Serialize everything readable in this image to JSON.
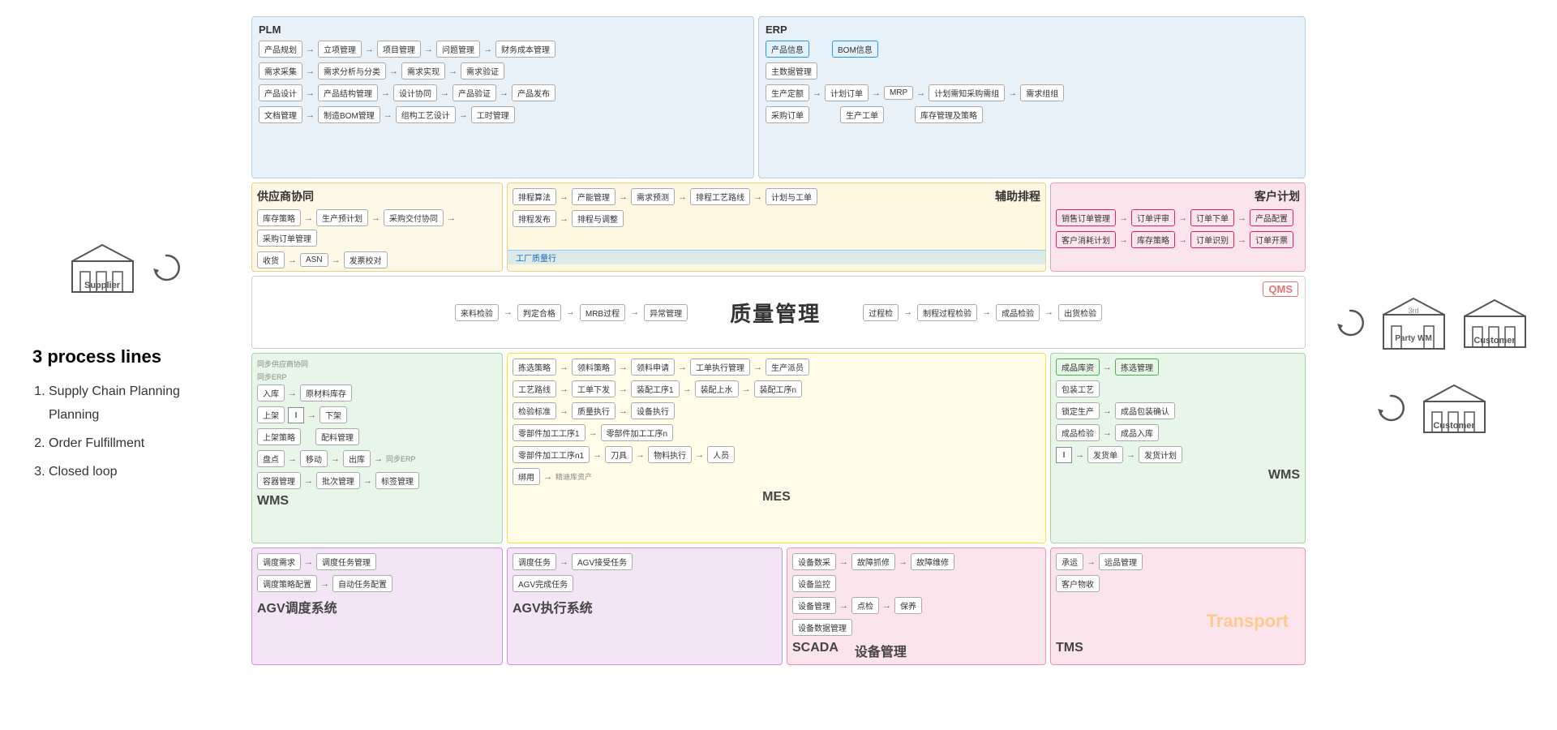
{
  "left": {
    "supplier_label": "Supplier",
    "process_title": "3 process lines",
    "process_items": [
      "Supply Chain Planning",
      "Order Fulfillment",
      "Closed loop"
    ]
  },
  "right": {
    "third_party_label": "3rd\nParty WM",
    "customer1_label": "Customer",
    "customer2_label": "Customer"
  },
  "diagram": {
    "plm_title": "PLM",
    "erp_title": "ERP",
    "supplier_coop_title": "供应商协同",
    "scheduling_title": "辅助排程",
    "customer_plan_title": "客户计划",
    "quality_title": "质量管理",
    "wms_left_title": "WMS",
    "mes_title": "MES",
    "wms_right_title": "WMS",
    "agv_left_title": "AGV调度系统",
    "agv_mid_title": "AGV执行系统",
    "scada_title": "SCADA",
    "equipment_title": "设备管理",
    "tms_title": "TMS",
    "qms_label": "QMS",
    "transport_label": "Transport"
  },
  "plm_nodes": [
    "产品规划",
    "立项管理",
    "项目管理",
    "问题管理",
    "财务成本管理",
    "需求采集",
    "需求分析与分类",
    "需求实现",
    "需求验证",
    "产品设计",
    "产品结构管理",
    "设计协同",
    "产品验证",
    "产品发布",
    "文档管理",
    "制造BOM管理",
    "组构工艺设计",
    "工时管理"
  ],
  "erp_nodes": [
    "产品信息",
    "BOM信息",
    "主数据管理",
    "生产定额",
    "计划订单",
    "MRP",
    "计划需知采购需组",
    "需求组组",
    "库存管理及策略",
    "采购订单",
    "生产工单"
  ],
  "supplier_nodes": [
    "库存策略",
    "生产预计划",
    "采购交付协同",
    "采购订单管理",
    "收货",
    "ASN",
    "发票校对"
  ],
  "scheduling_nodes": [
    "排程算法",
    "产能管理",
    "需求预测",
    "排程工艺路线",
    "计划与工单",
    "排程发布",
    "排程与调整"
  ],
  "customer_plan_nodes": [
    "销售订单管理",
    "订单评审",
    "订单下单",
    "产品配置",
    "客户消耗计划",
    "库存策略",
    "订单识别",
    "订单开票"
  ],
  "quality_nodes": [
    "来料检验",
    "判定合格",
    "MRB过程",
    "异常管理",
    "过程检",
    "制程过程检验",
    "成品检验",
    "出货检验"
  ],
  "wms_nodes": [
    "同步供应商协同",
    "同步ERP",
    "入库",
    "原材料库存",
    "上架",
    "下架",
    "上架策略",
    "盘点",
    "移动",
    "出库",
    "配料管理",
    "容器管理",
    "批次管理",
    "标签管理"
  ],
  "mes_nodes": [
    "拣选策略",
    "领料策略",
    "领料申请",
    "工单执行管理",
    "生产派员",
    "工艺路线",
    "工单下发",
    "装配工序1",
    "装配上水",
    "装配工序n",
    "检验标准",
    "质量执行",
    "设备执行",
    "零部件加工工序1",
    "零部件加工工序n",
    "零部件加工工序n1",
    "刀具",
    "物料执行",
    "人员",
    "绑用"
  ],
  "mes_right_nodes": [
    "成品库资",
    "拣选管理",
    "发货单",
    "发货计划",
    "成品入库",
    "包装工艺",
    "锁定生产",
    "成品包装确认",
    "成品检验"
  ],
  "agv_left_nodes": [
    "调度需求",
    "调度任务管理",
    "调度策略配置",
    "自动任务配置"
  ],
  "agv_mid_nodes": [
    "调度任务",
    "AGV接受任务",
    "AGV完成任务"
  ],
  "scada_nodes": [
    "设备数采",
    "设备监控",
    "设备数据管理"
  ],
  "equipment_nodes": [
    "故障抓修",
    "故障维修",
    "设备管理",
    "点检",
    "保养"
  ],
  "tms_nodes": [
    "承运",
    "运品管理",
    "客户物收"
  ]
}
